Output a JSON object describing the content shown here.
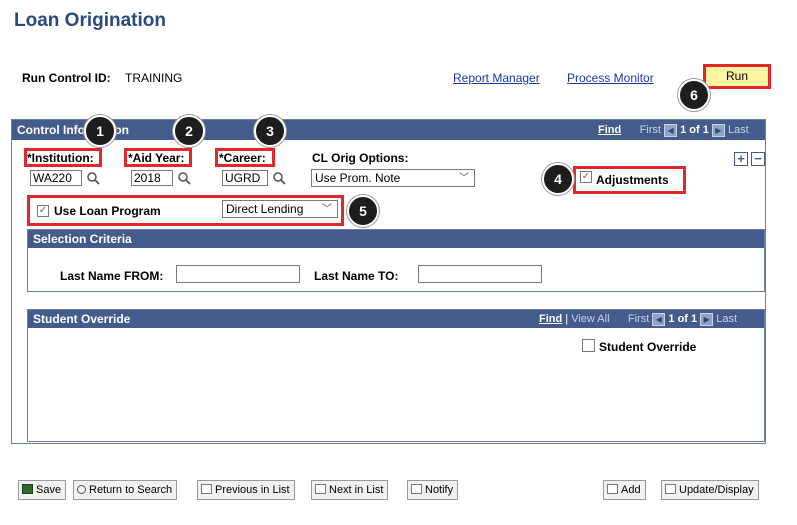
{
  "page_title": "Loan Origination",
  "run_control": {
    "label": "Run Control ID:",
    "value": "TRAINING"
  },
  "links": {
    "report_manager": "Report Manager",
    "process_monitor": "Process Monitor"
  },
  "run_button": "Run",
  "control_panel": {
    "title": "Control Information",
    "nav": {
      "find": "Find",
      "first": "First",
      "count": "1 of 1",
      "last": "Last"
    },
    "institution": {
      "label": "*Institution:",
      "value": "WA220"
    },
    "aid_year": {
      "label": "*Aid Year:",
      "value": "2018"
    },
    "career": {
      "label": "*Career:",
      "value": "UGRD"
    },
    "cl_orig_options": {
      "label": "CL Orig Options:",
      "value": "Use Prom. Note"
    },
    "adjustments": {
      "label": "Adjustments",
      "checked": true
    },
    "use_loan_program": {
      "label": "Use Loan Program",
      "checked": true,
      "value": "Direct Lending"
    },
    "add_symbol": "+",
    "remove_symbol": "−"
  },
  "selection_criteria": {
    "title": "Selection Criteria",
    "last_name_from": {
      "label": "Last Name FROM:",
      "value": ""
    },
    "last_name_to": {
      "label": "Last Name TO:",
      "value": ""
    }
  },
  "student_override": {
    "title": "Student Override",
    "nav": {
      "find": "Find",
      "separator": "|",
      "view_all": "View All",
      "first": "First",
      "count": "1 of 1",
      "last": "Last"
    },
    "checkbox_label": "Student Override"
  },
  "callouts": [
    "1",
    "2",
    "3",
    "4",
    "5",
    "6"
  ],
  "toolbar": {
    "save": "Save",
    "return_to_search": "Return to Search",
    "previous_in_list": "Previous in List",
    "next_in_list": "Next in List",
    "notify": "Notify",
    "add": "Add",
    "update_display": "Update/Display"
  },
  "colors": {
    "header_blue": "#445c8c",
    "title_blue": "#2a4a7a",
    "highlight_red": "#e3262a",
    "run_yellow": "#fff5a0"
  }
}
